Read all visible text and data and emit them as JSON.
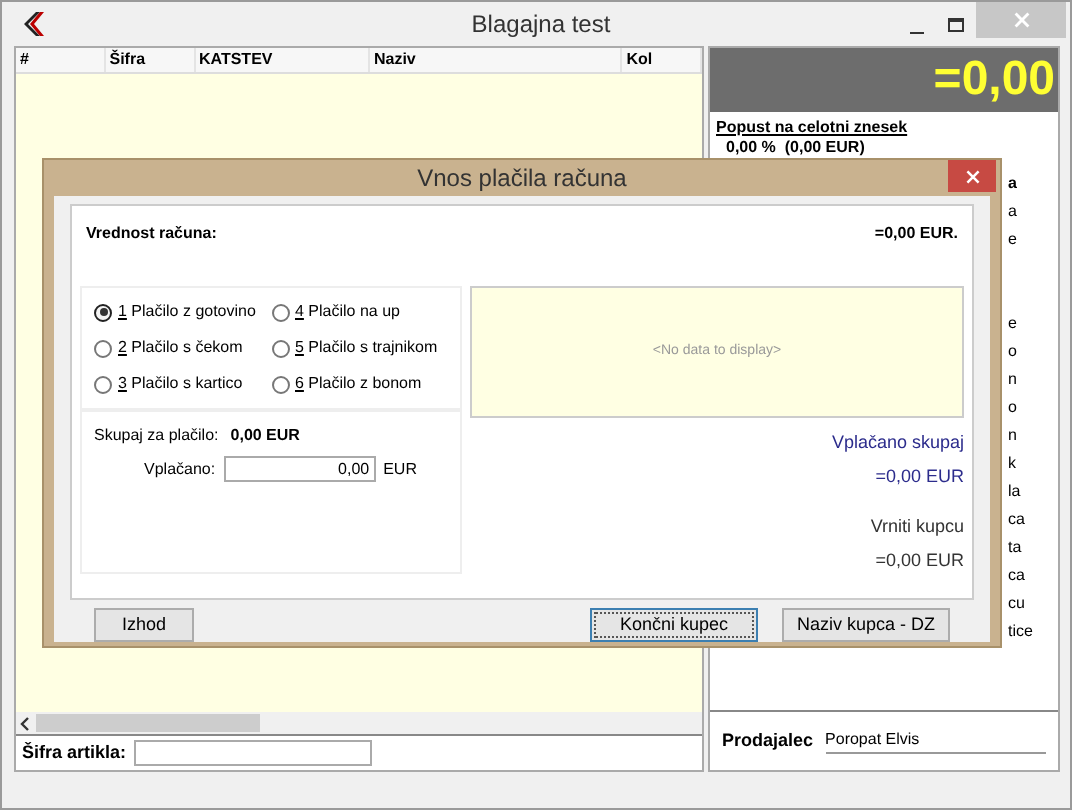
{
  "window": {
    "title": "Blagajna test"
  },
  "table": {
    "columns": [
      "#",
      "Šifra",
      "KATSTEV",
      "Naziv",
      "Kol"
    ]
  },
  "right_panel": {
    "total": "=0,00",
    "discount_label": "Popust na celotni znesek",
    "discount_value": "0,00 %  (0,00 EUR)",
    "fragment_heading": "a",
    "fragments_top": [
      "a",
      "e"
    ],
    "fragments_bottom": [
      "e",
      "o",
      "n",
      "o",
      "n",
      "k",
      "la",
      "ca",
      "ta",
      "ca",
      "cu",
      "tice"
    ],
    "seller_label": "Prodajalec",
    "seller_name": "Poropat Elvis"
  },
  "article": {
    "label": "Šifra artikla:"
  },
  "dialog": {
    "title": "Vnos plačila računa",
    "invoice_label": "Vrednost računa:",
    "invoice_value": "=0,00 EUR.",
    "payment_options": [
      {
        "label": "1 Plačilo z gotovino",
        "selected": true
      },
      {
        "label": "4 Plačilo na up",
        "selected": false
      },
      {
        "label": "2 Plačilo s čekom",
        "selected": false
      },
      {
        "label": "5 Plačilo s trajnikom",
        "selected": false
      },
      {
        "label": "3 Plačilo s kartico",
        "selected": false
      },
      {
        "label": "6 Plačilo z bonom",
        "selected": false
      }
    ],
    "total_label": "Skupaj za plačilo:",
    "total_value": "0,00 EUR",
    "paid_label": "Vplačano:",
    "paid_value": "0,00",
    "currency": "EUR",
    "grid_empty": "<No data to display>",
    "paid_total_label": "Vplačano skupaj",
    "paid_total_value": "=0,00 EUR",
    "change_label": "Vrniti kupcu",
    "change_value": "=0,00 EUR",
    "buttons": [
      {
        "label": "Izhod",
        "focused": false
      },
      {
        "label": "Končni kupec",
        "focused": true
      },
      {
        "label": "Naziv kupca - DZ",
        "focused": false
      }
    ]
  }
}
